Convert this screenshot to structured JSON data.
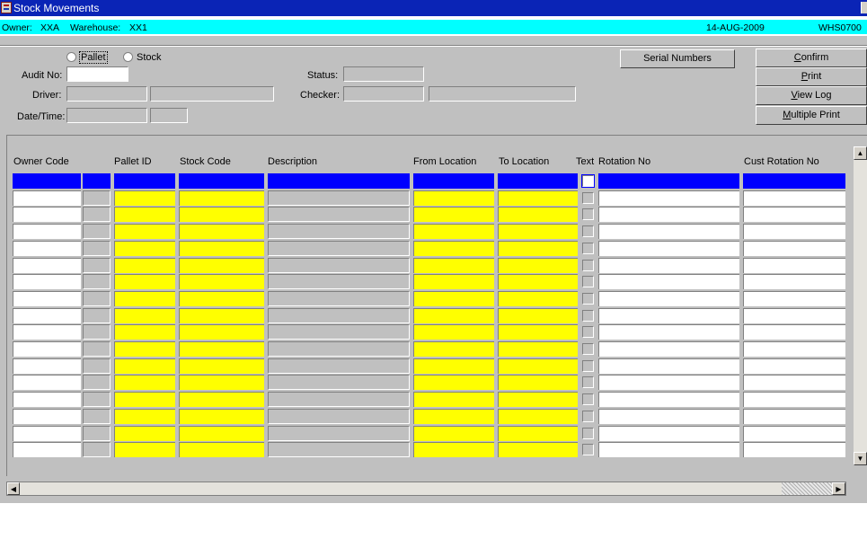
{
  "window": {
    "title": "Stock Movements"
  },
  "infobar": {
    "owner_label": "Owner:",
    "owner_value": "XXA",
    "warehouse_label": "Warehouse:",
    "warehouse_value": "XX1",
    "date": "14-AUG-2009",
    "screen_code": "WHS0700"
  },
  "form": {
    "radio_pallet": "Pallet",
    "radio_stock": "Stock",
    "audit_no_label": "Audit No:",
    "driver_label": "Driver:",
    "datetime_label": "Date/Time:",
    "status_label": "Status:",
    "checker_label": "Checker:"
  },
  "buttons": {
    "serial_numbers": "Serial Numbers",
    "confirm": "Confirm",
    "print": "Print",
    "view_log": "View Log",
    "multiple_print": "Multiple Print"
  },
  "grid": {
    "headers": {
      "owner_code": "Owner Code",
      "pallet_id": "Pallet ID",
      "stock_code": "Stock Code",
      "description": "Description",
      "from_location": "From Location",
      "to_location": "To Location",
      "text": "Text",
      "rotation_no": "Rotation No",
      "cust_rotation_no": "Cust Rotation No"
    },
    "row_count": 17
  },
  "colors": {
    "titlebar": "#0a24b6",
    "infobar": "#00ffff",
    "panel": "#c0c0c0",
    "selected_row": "#0000ff",
    "required_field": "#ffff00"
  }
}
